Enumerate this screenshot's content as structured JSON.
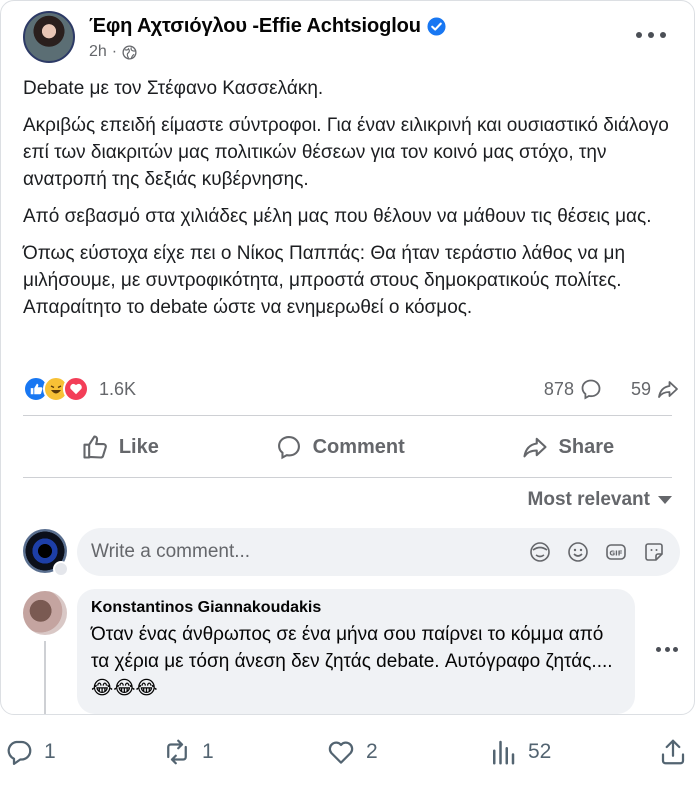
{
  "post": {
    "author": "Έφη Αχτσιόγλου -Effie Achtsioglou",
    "time": "2h",
    "paragraphs": [
      "Debate με τον Στέφανο Κασσελάκη.",
      "Ακριβώς επειδή είμαστε σύντροφοι. Για έναν ειλικρινή και ουσιαστικό διάλογο επί των διακριτών μας πολιτικών θέσεων για τον κοινό μας στόχο, την ανατροπή της δεξιάς κυβέρνησης.",
      "Από σεβασμό στα χιλιάδες μέλη μας που θέλουν να μάθουν τις θέσεις μας.",
      "Όπως εύστοχα είχε πει ο Νίκος Παππάς: Θα ήταν τεράστιο λάθος να μη μιλήσουμε, με συντροφικότητα, μπροστά στους δημοκρατικούς πολίτες. Απαραίτητο το debate ώστε να ενημερωθεί ο κόσμος."
    ],
    "reactions_count": "1.6K",
    "comments_count": "878",
    "shares_count": "59"
  },
  "actions": {
    "like": "Like",
    "comment": "Comment",
    "share": "Share"
  },
  "sort": "Most relevant",
  "comment_box": {
    "placeholder": "Write a comment..."
  },
  "comment": {
    "author": "Konstantinos Giannakoudakis",
    "text": "Όταν ένας άνθρωπος σε ένα μήνα σου παίρνει το κόμμα από τα χέρια με τόση άνεση δεν ζητάς debate. Αυτόγραφο ζητάς....😂😂😂"
  },
  "tweet_footer": {
    "replies": "1",
    "retweets": "1",
    "likes": "2",
    "views": "52"
  },
  "colors": {
    "facebook_blue": "#1877f2",
    "secondary_text": "#65676b",
    "bubble_bg": "#f0f2f5"
  }
}
